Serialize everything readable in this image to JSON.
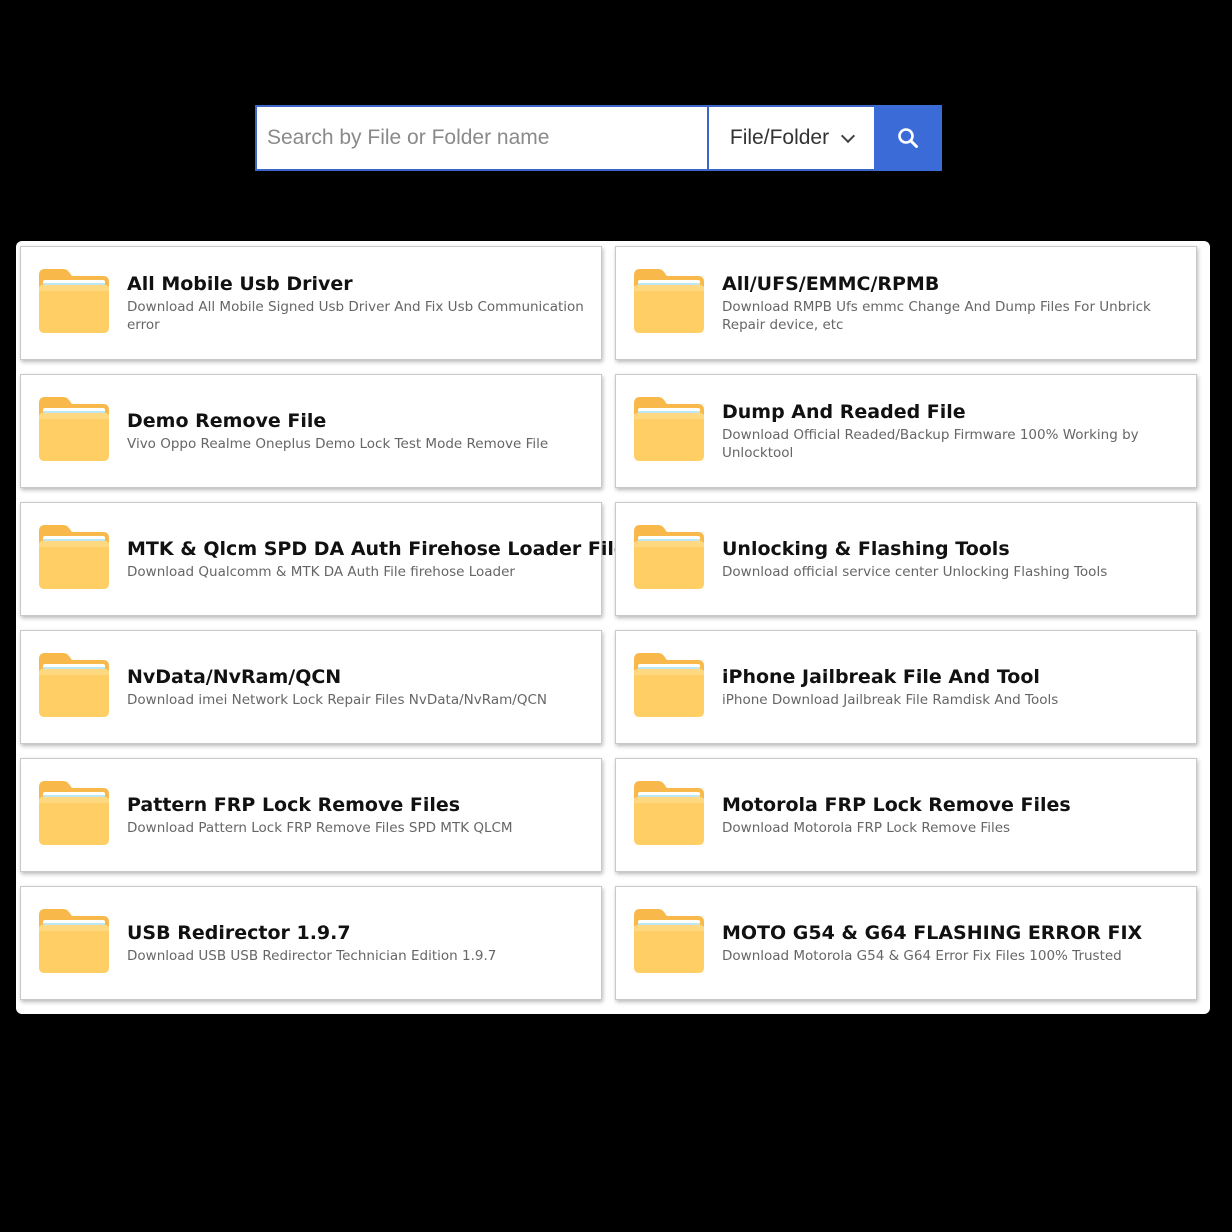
{
  "search": {
    "placeholder": "Search by File or Folder name",
    "value": "",
    "type_select": "File/Folder",
    "search_icon": "search-icon"
  },
  "colors": {
    "background": "#000000",
    "accent": "#3a6bd6",
    "folder": "#ffcf66",
    "folder_back": "#f9b94a",
    "title": "#111111",
    "description": "#666666"
  },
  "folders": [
    {
      "title": "All Mobile Usb Driver",
      "description": "Download All Mobile Signed Usb Driver And Fix Usb Communication error",
      "icon": "folder-icon"
    },
    {
      "title": "All/UFS/EMMC/RPMB",
      "description": "Download RMPB Ufs emmc Change And Dump Files For Unbrick Repair device, etc",
      "icon": "folder-icon"
    },
    {
      "title": "Demo Remove File",
      "description": "Vivo Oppo Realme Oneplus Demo Lock Test Mode Remove File",
      "icon": "folder-icon"
    },
    {
      "title": "Dump And Readed File",
      "description": "Download Official Readed/Backup Firmware 100% Working by Unlocktool",
      "icon": "folder-icon"
    },
    {
      "title": "MTK & Qlcm SPD DA Auth Firehose Loader Files",
      "description": "Download Qualcomm & MTK DA Auth File firehose Loader",
      "icon": "folder-icon"
    },
    {
      "title": "Unlocking & Flashing Tools",
      "description": "Download official service center Unlocking Flashing Tools",
      "icon": "folder-icon"
    },
    {
      "title": "NvData/NvRam/QCN",
      "description": "Download imei Network Lock Repair Files NvData/NvRam/QCN",
      "icon": "folder-icon"
    },
    {
      "title": "iPhone Jailbreak File And Tool",
      "description": "iPhone Download Jailbreak File Ramdisk And Tools",
      "icon": "folder-icon"
    },
    {
      "title": "Pattern FRP Lock Remove Files",
      "description": "Download Pattern Lock FRP Remove Files SPD MTK QLCM",
      "icon": "folder-icon"
    },
    {
      "title": "Motorola FRP Lock Remove Files",
      "description": "Download Motorola FRP Lock Remove Files",
      "icon": "folder-icon"
    },
    {
      "title": "USB Redirector 1.9.7",
      "description": "Download USB USB Redirector Technician Edition 1.9.7",
      "icon": "folder-icon"
    },
    {
      "title": "MOTO G54 & G64 FLASHING ERROR FIX",
      "description": "Download Motorola G54 & G64 Error Fix Files 100% Trusted",
      "icon": "folder-icon"
    }
  ]
}
